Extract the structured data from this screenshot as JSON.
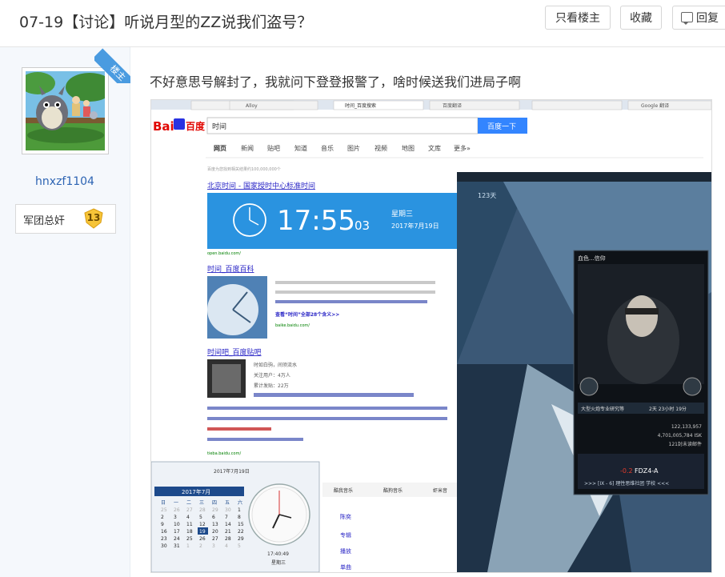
{
  "thread": {
    "title": "07-19【讨论】听说月型的ZZ说我们盗号？",
    "only_op_label": "只看楼主",
    "favorite_label": "收藏",
    "reply_label": "回复"
  },
  "poster": {
    "username": "hnxzf1104",
    "badge": "楼主",
    "rank_title": "军团总奸",
    "level": "13"
  },
  "post": {
    "text": "不好意思号解封了，我就问下登登报警了，啥时候送我们进局子啊"
  },
  "screenshot": {
    "browser_tabs": [
      "Alloy",
      "时间_百度搜索",
      "百度翻译",
      "Google 翻译"
    ],
    "search_query": "时间",
    "search_button": "百度一下",
    "nav_tabs": [
      "网页",
      "新闻",
      "贴吧",
      "知道",
      "音乐",
      "图片",
      "视频",
      "地图",
      "文库",
      "更多»"
    ],
    "result_count": "百度为您找到相关结果约100,000,000个",
    "result1_title": "北京时间 - 国家授时中心标准时间",
    "clock_time": "17:55",
    "clock_seconds": "03",
    "clock_weekday": "星期三",
    "clock_date": "2017年7月19日",
    "result1_url": "open.baidu.com/",
    "result2_title": "时间_百度百科",
    "result2_url": "baike.baidu.com/",
    "result3_title": "时间吧_百度贴吧",
    "result3_info": [
      "时如白驹，间须流水",
      "关注用户：4万人",
      "累计发贴：22万"
    ],
    "result3_url": "tieba.baidu.com/",
    "calendar_header": "2017年7月19日",
    "calendar_month": "2017年7月",
    "calendar_weekdays": [
      "日",
      "一",
      "二",
      "三",
      "四",
      "五",
      "六"
    ],
    "calendar_days": [
      "25",
      "26",
      "27",
      "28",
      "29",
      "30",
      "1",
      "2",
      "3",
      "4",
      "5",
      "6",
      "7",
      "8",
      "9",
      "10",
      "11",
      "12",
      "13",
      "14",
      "15",
      "16",
      "17",
      "18",
      "19",
      "20",
      "21",
      "22",
      "23",
      "24",
      "25",
      "26",
      "27",
      "28",
      "29",
      "30",
      "31",
      "1",
      "2",
      "3",
      "4",
      "5"
    ],
    "clock_small_time": "17:40:49",
    "clock_small_day": "星期三",
    "music_tabs": [
      "酷我音乐",
      "酷狗音乐",
      "虾米音"
    ],
    "music_items": [
      "陈奕",
      "专辑",
      "播放",
      "单曲"
    ],
    "game_days": "123天",
    "game_char_title": "血色...信仰",
    "game_char_role": "大型火炮专业研究等",
    "game_char_time": "2天 23小时 19分",
    "game_stat1": "122,133,957",
    "game_stat2": "4,701,005,784 ISK",
    "game_stat3": "121封未读邮件",
    "game_system_sec": "-0.2",
    "game_system": "FDZ4-A",
    "game_route": ">>> [IX - 6] 理性思维社团 学校 <<<"
  }
}
